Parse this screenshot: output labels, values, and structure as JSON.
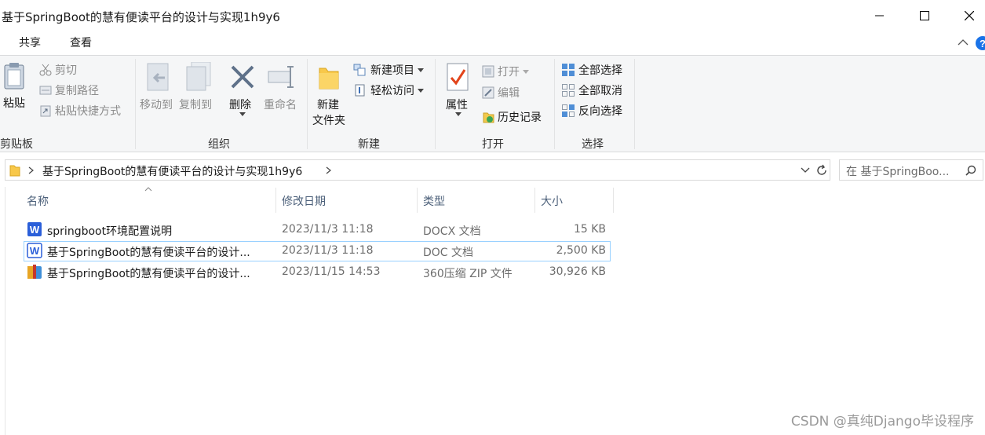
{
  "window": {
    "title": "基于SpringBoot的慧有便读平台的设计与实现1h9y6"
  },
  "ribbon_tabs": {
    "share": "共享",
    "view": "查看"
  },
  "ribbon": {
    "clipboard": {
      "paste": "粘贴",
      "cut": "剪切",
      "copy_path": "复制路径",
      "paste_shortcut": "粘贴快捷方式",
      "group_label": "剪贴板"
    },
    "organize": {
      "move_to": "移动到",
      "copy_to": "复制到",
      "delete": "删除",
      "rename": "重命名",
      "group_label": "组织"
    },
    "new": {
      "new_folder_line1": "新建",
      "new_folder_line2": "文件夹",
      "new_item": "新建项目",
      "easy_access": "轻松访问",
      "group_label": "新建"
    },
    "open": {
      "properties": "属性",
      "open": "打开",
      "edit": "编辑",
      "history": "历史记录",
      "group_label": "打开"
    },
    "select": {
      "select_all": "全部选择",
      "select_none": "全部取消",
      "invert_selection": "反向选择",
      "group_label": "选择"
    }
  },
  "address": {
    "path": "基于SpringBoot的慧有便读平台的设计与实现1h9y6",
    "search_placeholder": "在 基于SpringBoo..."
  },
  "columns": {
    "name": "名称",
    "date": "修改日期",
    "type": "类型",
    "size": "大小"
  },
  "files": [
    {
      "name": "springboot环境配置说明",
      "date": "2023/11/3 11:18",
      "type": "DOCX 文档",
      "size": "15 KB",
      "icon": "word-doc-icon"
    },
    {
      "name": "基于SpringBoot的慧有便读平台的设计...",
      "date": "2023/11/3 11:18",
      "type": "DOC 文档",
      "size": "2,500 KB",
      "icon": "word-doc-icon"
    },
    {
      "name": "基于SpringBoot的慧有便读平台的设计...",
      "date": "2023/11/15 14:53",
      "type": "360压缩 ZIP 文件",
      "size": "30,926 KB",
      "icon": "zip-archive-icon"
    }
  ],
  "watermark": "CSDN @真纯Django毕设程序",
  "colors": {
    "ribbon_bg": "#f5f6f7",
    "header_text": "#4c607a",
    "selection_border": "#99d1ff",
    "word_blue": "#2b5fd9",
    "help_blue": "#1a73e8"
  }
}
